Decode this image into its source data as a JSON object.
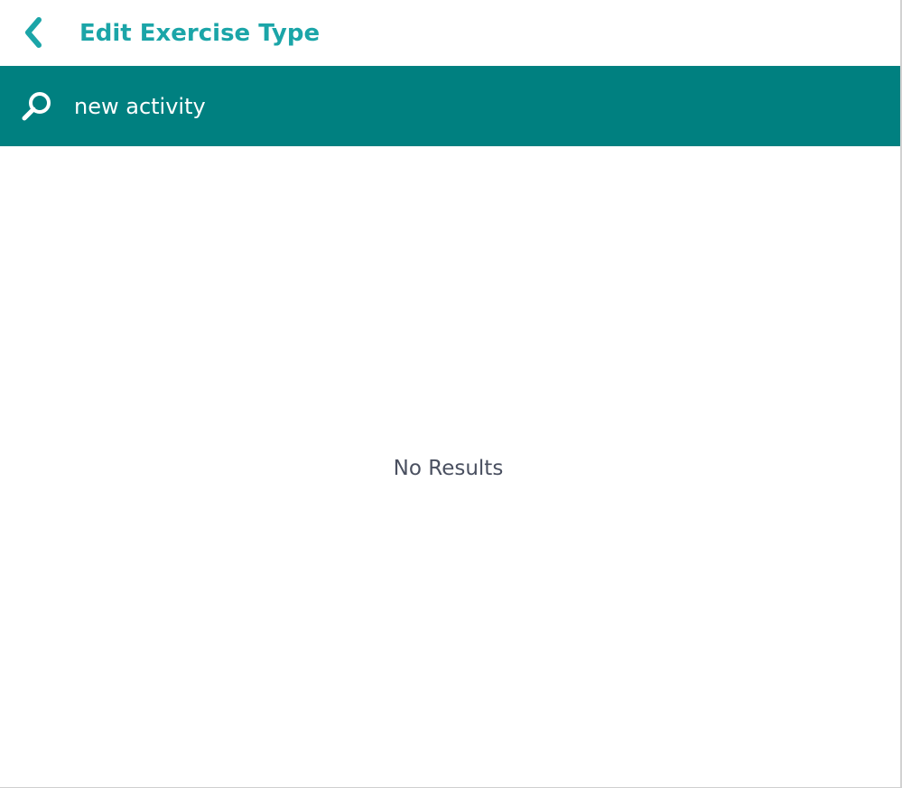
{
  "header": {
    "back_icon": "chevron-left-icon",
    "title": "Edit Exercise Type"
  },
  "search": {
    "icon": "search-icon",
    "value": "new activity",
    "placeholder": ""
  },
  "results": {
    "empty_message": "No Results"
  },
  "colors": {
    "accent": "#1ba5a8",
    "search_bar_bg": "#008080",
    "search_text": "#ffffff",
    "empty_text": "#4a5060",
    "background": "#ffffff"
  }
}
